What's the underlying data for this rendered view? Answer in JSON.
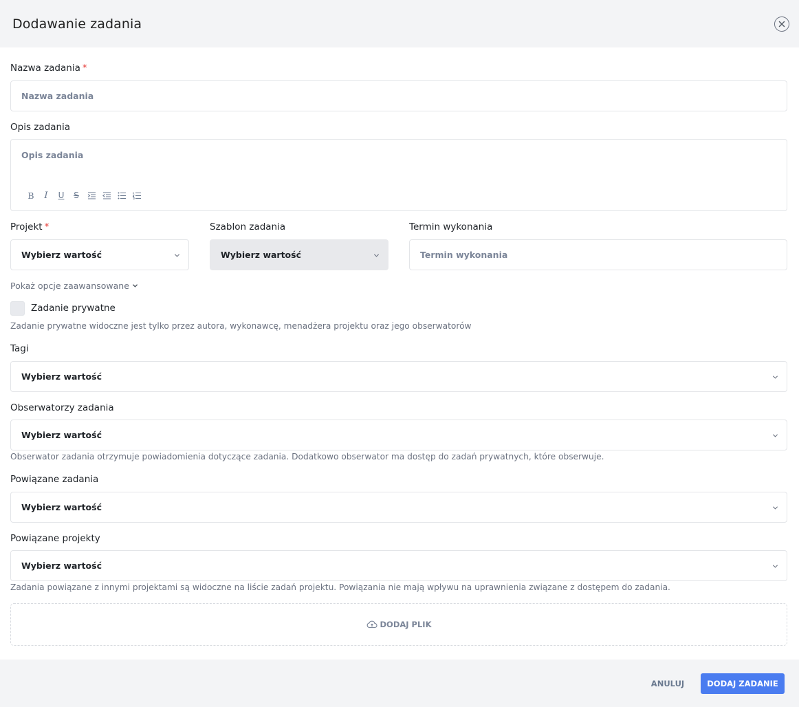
{
  "dialog": {
    "title": "Dodawanie zadania"
  },
  "fields": {
    "task_name": {
      "label": "Nazwa zadania",
      "required": "*",
      "placeholder": "Nazwa zadania"
    },
    "description": {
      "label": "Opis zadania",
      "placeholder": "Opis zadania",
      "toolbar": [
        "B",
        "I",
        "U",
        "S",
        "indent",
        "outdent",
        "bulleted-list",
        "numbered-list"
      ]
    },
    "project": {
      "label": "Projekt",
      "required": "*",
      "value": "Wybierz wartość"
    },
    "template": {
      "label": "Szablon zadania",
      "value": "Wybierz wartość"
    },
    "due_date": {
      "label": "Termin wykonania",
      "placeholder": "Termin wykonania"
    },
    "advanced_toggle": "Pokaż opcje zaawansowane",
    "private": {
      "label": "Zadanie prywatne",
      "helper": "Zadanie prywatne widoczne jest tylko przez autora, wykonawcę, menadżera projektu oraz jego obserwatorów",
      "checked": false
    },
    "tags": {
      "label": "Tagi",
      "value": "Wybierz wartość"
    },
    "observers": {
      "label": "Obserwatorzy zadania",
      "value": "Wybierz wartość",
      "helper": "Obserwator zadania otrzymuje powiadomienia dotyczące zadania. Dodatkowo obserwator ma dostęp do zadań prywatnych, które obserwuje."
    },
    "related_tasks": {
      "label": "Powiązane zadania",
      "value": "Wybierz wartość"
    },
    "related_projects": {
      "label": "Powiązane projekty",
      "value": "Wybierz wartość",
      "helper": "Zadania powiązane z innymi projektami są widoczne na liście zadań projektu. Powiązania nie mają wpływu na uprawnienia związane z dostępem do zadania."
    },
    "upload": {
      "label": "DODAJ PLIK"
    }
  },
  "footer": {
    "cancel_label": "ANULUJ",
    "submit_label": "DODAJ ZADANIE"
  },
  "colors": {
    "accent": "#4a7cf0",
    "required": "#e53935",
    "header_bg": "#f3f4f6"
  }
}
